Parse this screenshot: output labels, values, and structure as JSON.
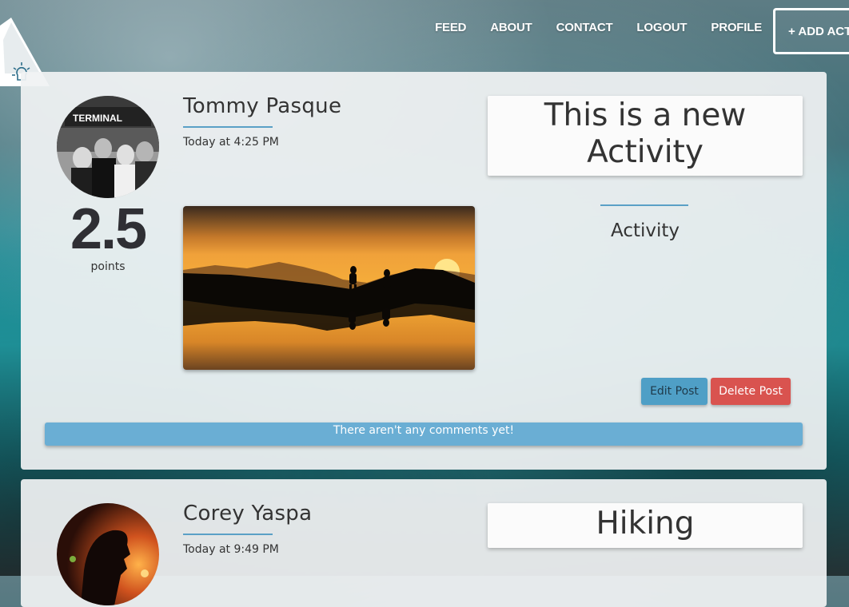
{
  "nav": {
    "items": [
      "FEED",
      "ABOUT",
      "CONTACT",
      "LOGOUT",
      "PROFILE"
    ],
    "add_button": "+ ADD ACT"
  },
  "posts": [
    {
      "author": "Tommy Pasque",
      "timestamp": "Today at 4:25 PM",
      "points": "2.5",
      "points_label": "points",
      "title": "This is a new Activity",
      "type": "Activity",
      "edit_label": "Edit Post",
      "delete_label": "Delete Post",
      "comments_text": "There aren't any comments yet!",
      "avatar_sign": "TERMINAL"
    },
    {
      "author": "Corey Yaspa",
      "timestamp": "Today at 9:49 PM",
      "title": "Hiking"
    }
  ],
  "colors": {
    "accent": "#5aa0c6",
    "edit_button": "#4f9fc6",
    "delete_button": "#d9534f",
    "comments_bar": "#6aaed4"
  }
}
